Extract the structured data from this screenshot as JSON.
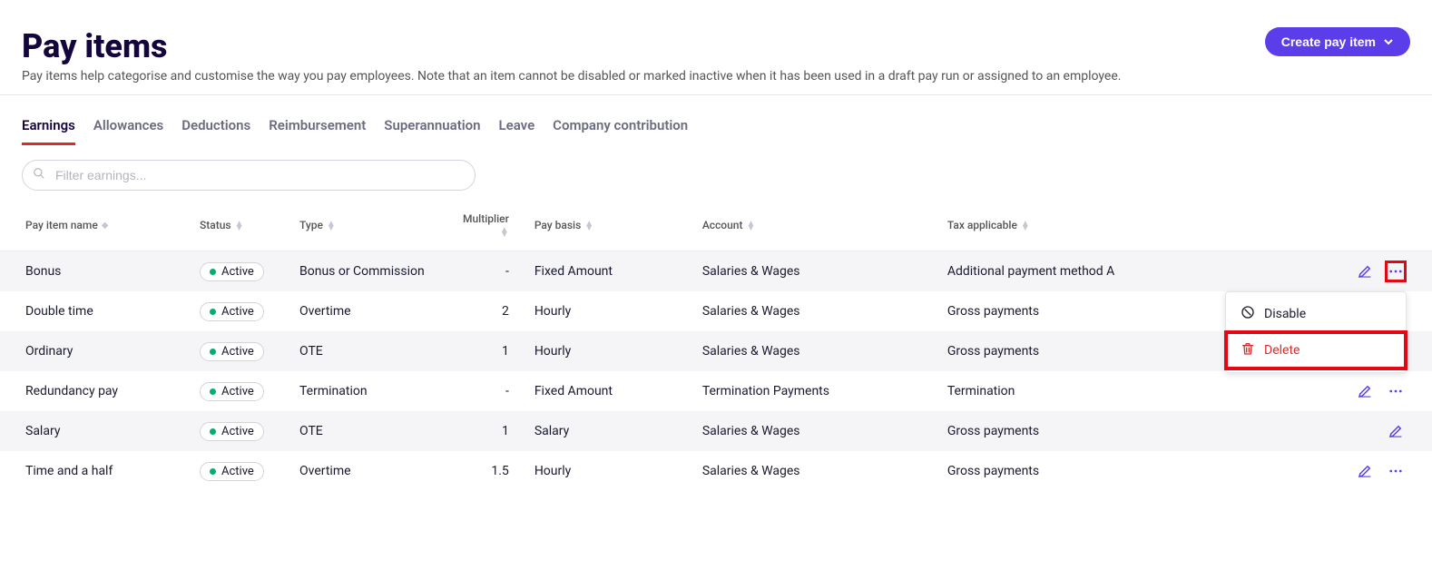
{
  "header": {
    "title": "Pay items",
    "subtitle": "Pay items help categorise and customise the way you pay employees. Note that an item cannot be disabled or marked inactive when it has been used in a draft pay run or assigned to an employee.",
    "create_button": "Create pay item"
  },
  "tabs": [
    {
      "label": "Earnings",
      "active": true
    },
    {
      "label": "Allowances",
      "active": false
    },
    {
      "label": "Deductions",
      "active": false
    },
    {
      "label": "Reimbursement",
      "active": false
    },
    {
      "label": "Superannuation",
      "active": false
    },
    {
      "label": "Leave",
      "active": false
    },
    {
      "label": "Company contribution",
      "active": false
    }
  ],
  "search": {
    "placeholder": "Filter earnings..."
  },
  "table": {
    "columns": [
      {
        "key": "name",
        "label": "Pay item name",
        "sortable": "single"
      },
      {
        "key": "status",
        "label": "Status",
        "sortable": "double"
      },
      {
        "key": "type",
        "label": "Type",
        "sortable": "double"
      },
      {
        "key": "multiplier",
        "label": "Multiplier",
        "sortable": "double"
      },
      {
        "key": "basis",
        "label": "Pay basis",
        "sortable": "double"
      },
      {
        "key": "account",
        "label": "Account",
        "sortable": "double"
      },
      {
        "key": "tax",
        "label": "Tax applicable",
        "sortable": "double"
      }
    ],
    "rows": [
      {
        "name": "Bonus",
        "status": "Active",
        "type": "Bonus or Commission",
        "multiplier": "-",
        "basis": "Fixed Amount",
        "account": "Salaries & Wages",
        "tax": "Additional payment method A",
        "show_more": true,
        "menu_open": true,
        "highlight_more": true
      },
      {
        "name": "Double time",
        "status": "Active",
        "type": "Overtime",
        "multiplier": "2",
        "basis": "Hourly",
        "account": "Salaries & Wages",
        "tax": "Gross payments",
        "show_more": false
      },
      {
        "name": "Ordinary",
        "status": "Active",
        "type": "OTE",
        "multiplier": "1",
        "basis": "Hourly",
        "account": "Salaries & Wages",
        "tax": "Gross payments",
        "show_more": false
      },
      {
        "name": "Redundancy pay",
        "status": "Active",
        "type": "Termination",
        "multiplier": "-",
        "basis": "Fixed Amount",
        "account": "Termination Payments",
        "tax": "Termination",
        "show_more": true
      },
      {
        "name": "Salary",
        "status": "Active",
        "type": "OTE",
        "multiplier": "1",
        "basis": "Salary",
        "account": "Salaries & Wages",
        "tax": "Gross payments",
        "show_more": false
      },
      {
        "name": "Time and a half",
        "status": "Active",
        "type": "Overtime",
        "multiplier": "1.5",
        "basis": "Hourly",
        "account": "Salaries & Wages",
        "tax": "Gross payments",
        "show_more": true
      }
    ]
  },
  "dropdown": {
    "disable": "Disable",
    "delete": "Delete"
  }
}
